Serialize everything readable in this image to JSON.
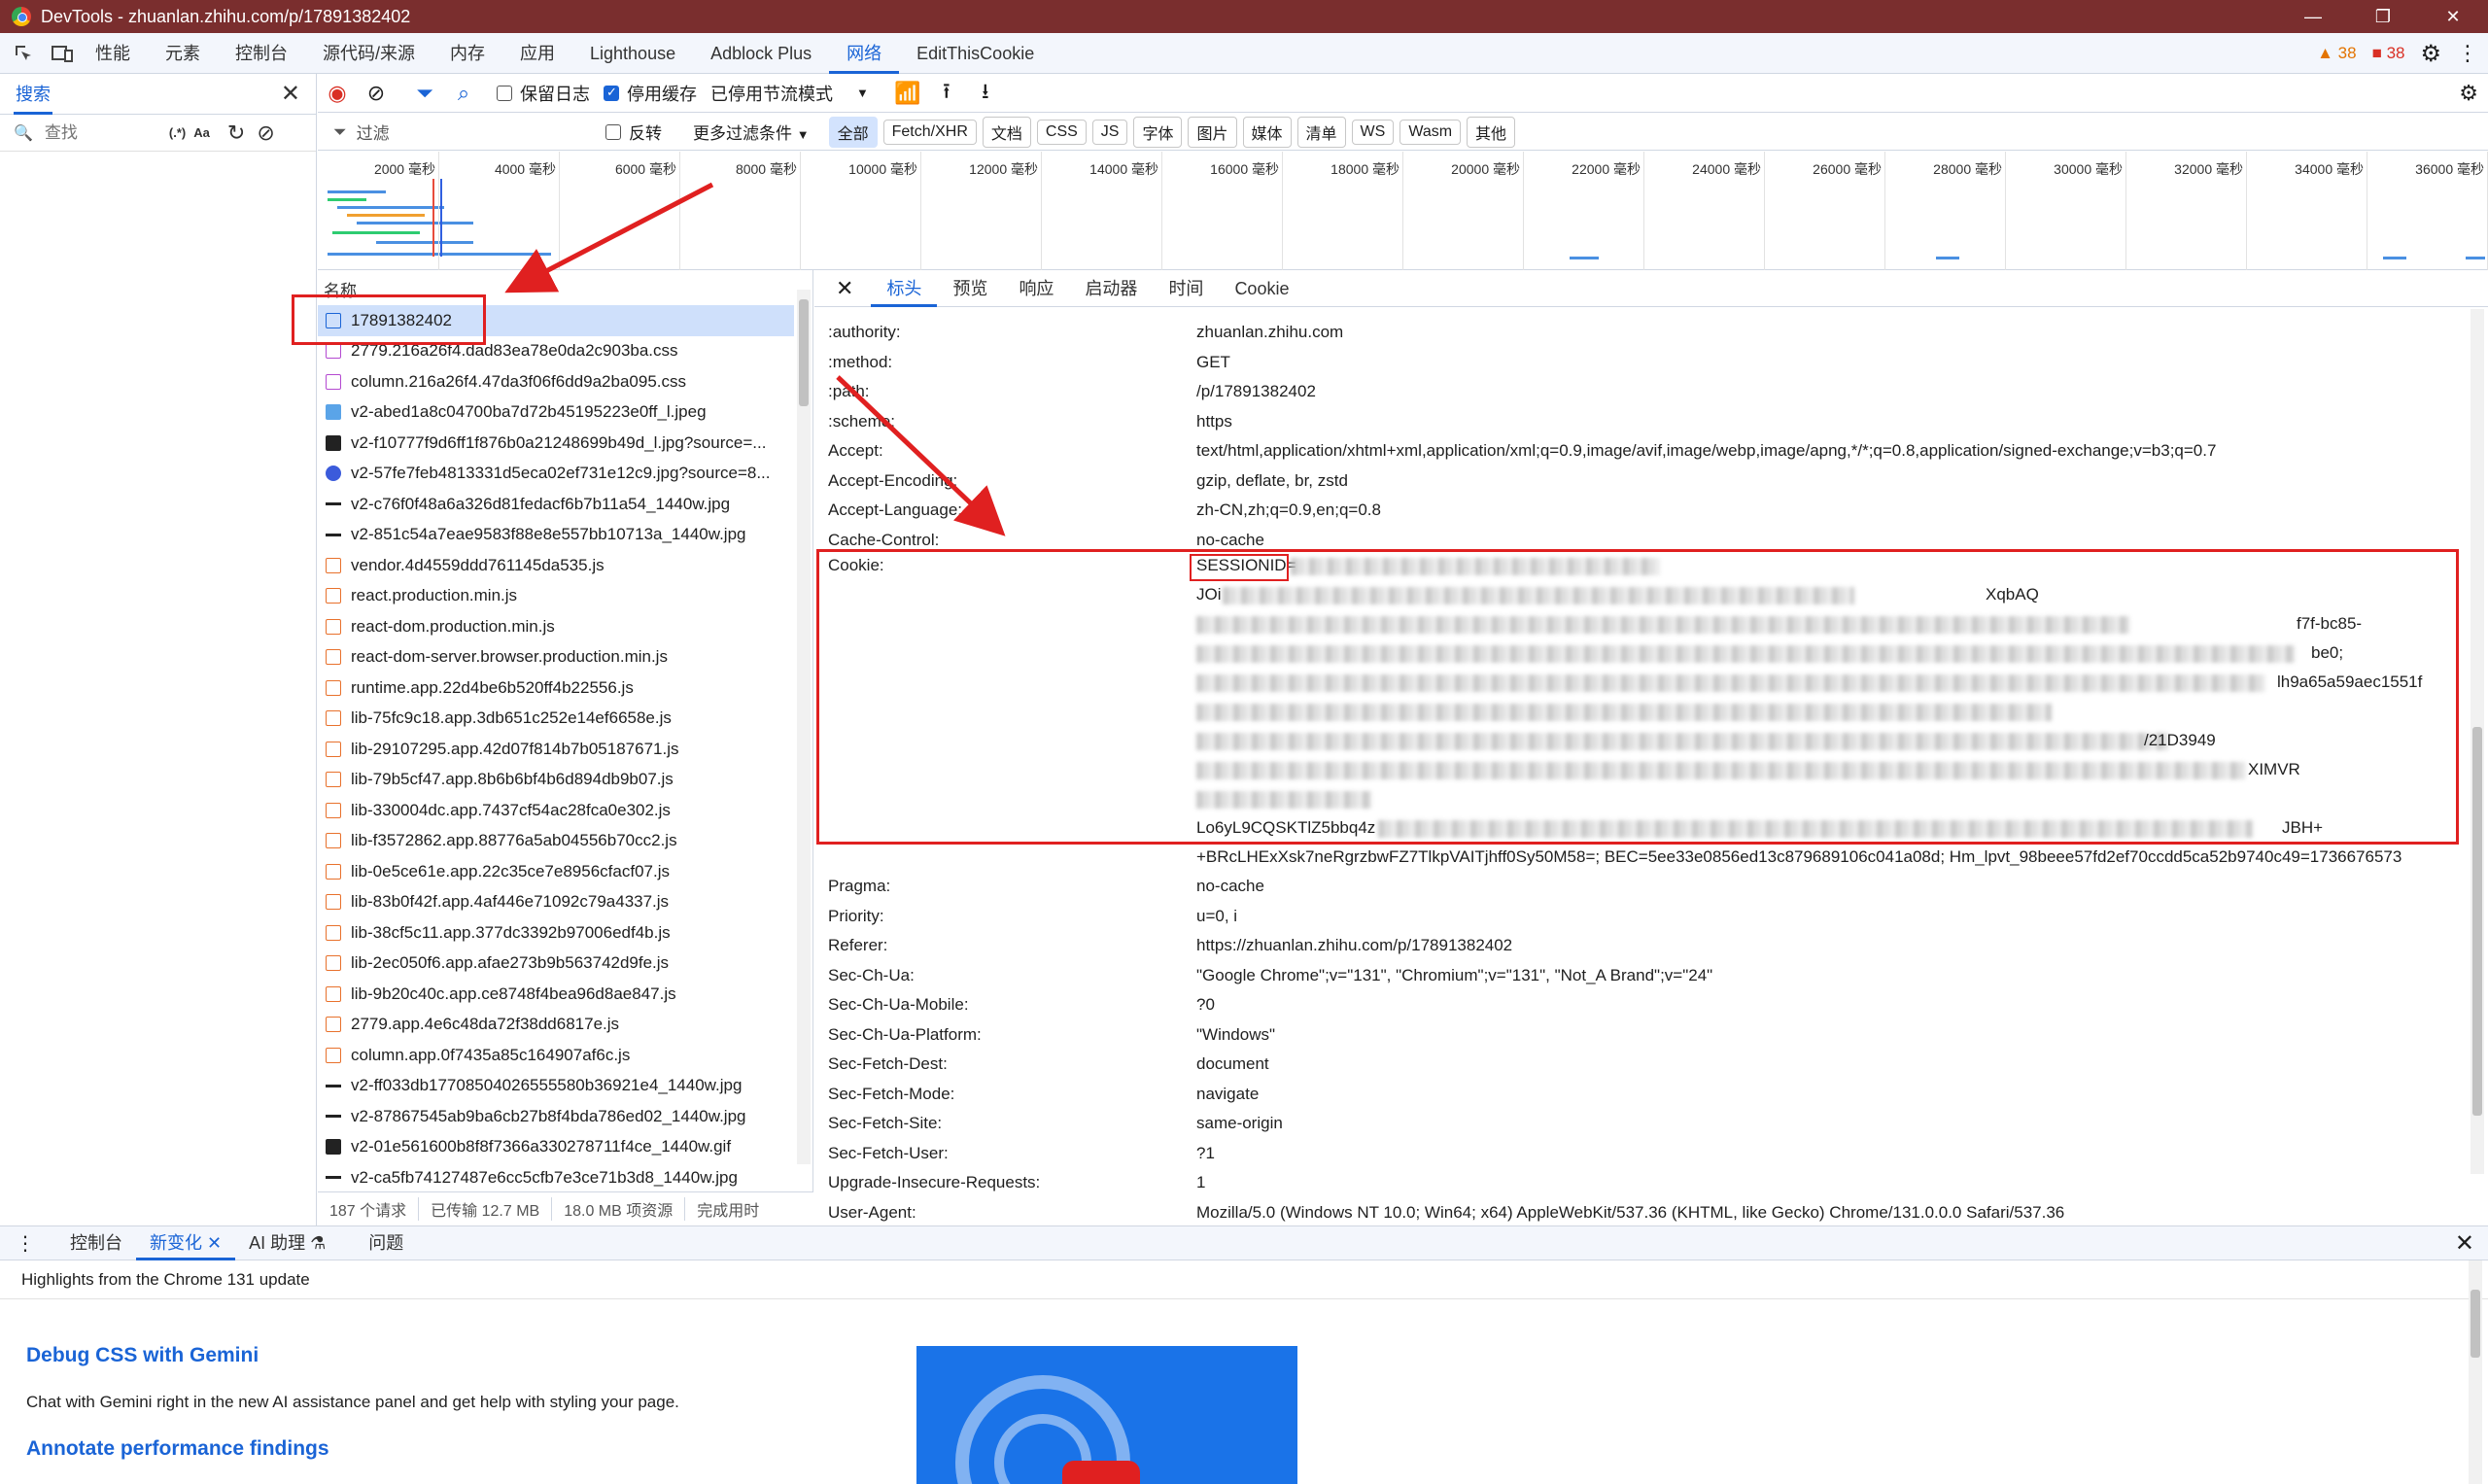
{
  "window": {
    "title": "DevTools - zhuanlan.zhihu.com/p/17891382402",
    "controls": [
      "—",
      "❐",
      "✕"
    ]
  },
  "main_tabs": [
    "性能",
    "元素",
    "控制台",
    "源代码/来源",
    "内存",
    "应用",
    "Lighthouse",
    "Adblock Plus",
    "网络",
    "EditThisCookie"
  ],
  "active_main_tab": "网络",
  "warnings_count": "38",
  "errors_count": "38",
  "search_panel": {
    "tab_label": "搜索",
    "placeholder": "查找",
    "regex_label": "(.*)",
    "case_label": "Aa"
  },
  "network_toolbar": {
    "preserve_log": "保留日志",
    "disable_cache": "停用缓存",
    "throttle": "已停用节流模式"
  },
  "filter_row": {
    "placeholder": "过滤",
    "invert": "反转",
    "more_filters": "更多过滤条件",
    "chips": [
      "全部",
      "Fetch/XHR",
      "文档",
      "CSS",
      "JS",
      "字体",
      "图片",
      "媒体",
      "清单",
      "WS",
      "Wasm",
      "其他"
    ]
  },
  "timeline_ticks": [
    "2000 毫秒",
    "4000 毫秒",
    "6000 毫秒",
    "8000 毫秒",
    "10000 毫秒",
    "12000 毫秒",
    "14000 毫秒",
    "16000 毫秒",
    "18000 毫秒",
    "20000 毫秒",
    "22000 毫秒",
    "24000 毫秒",
    "26000 毫秒",
    "28000 毫秒",
    "30000 毫秒",
    "32000 毫秒",
    "34000 毫秒",
    "36000 毫秒"
  ],
  "request_list": {
    "header": "名称",
    "rows": [
      {
        "name": "17891382402",
        "type": "doc"
      },
      {
        "name": "2779.216a26f4.dad83ea78e0da2c903ba.css",
        "type": "css"
      },
      {
        "name": "column.216a26f4.47da3f06f6dd9a2ba095.css",
        "type": "css"
      },
      {
        "name": "v2-abed1a8c04700ba7d72b45195223e0ff_l.jpeg",
        "type": "img"
      },
      {
        "name": "v2-f10777f9d6ff1f876b0a21248699b49d_l.jpg?source=...",
        "type": "imgd"
      },
      {
        "name": "v2-57fe7feb4813331d5eca02ef731e12c9.jpg?source=8...",
        "type": "bluecirc"
      },
      {
        "name": "v2-c76f0f48a6a326d81fedacf6b7b11a54_1440w.jpg",
        "type": "line"
      },
      {
        "name": "v2-851c54a7eae9583f88e8e557bb10713a_1440w.jpg",
        "type": "line"
      },
      {
        "name": "vendor.4d4559ddd761145da535.js",
        "type": "js"
      },
      {
        "name": "react.production.min.js",
        "type": "js"
      },
      {
        "name": "react-dom.production.min.js",
        "type": "js"
      },
      {
        "name": "react-dom-server.browser.production.min.js",
        "type": "js"
      },
      {
        "name": "runtime.app.22d4be6b520ff4b22556.js",
        "type": "js"
      },
      {
        "name": "lib-75fc9c18.app.3db651c252e14ef6658e.js",
        "type": "js"
      },
      {
        "name": "lib-29107295.app.42d07f814b7b05187671.js",
        "type": "js"
      },
      {
        "name": "lib-79b5cf47.app.8b6b6bf4b6d894db9b07.js",
        "type": "js"
      },
      {
        "name": "lib-330004dc.app.7437cf54ac28fca0e302.js",
        "type": "js"
      },
      {
        "name": "lib-f3572862.app.88776a5ab04556b70cc2.js",
        "type": "js"
      },
      {
        "name": "lib-0e5ce61e.app.22c35ce7e8956cfacf07.js",
        "type": "js"
      },
      {
        "name": "lib-83b0f42f.app.4af446e71092c79a4337.js",
        "type": "js"
      },
      {
        "name": "lib-38cf5c11.app.377dc3392b97006edf4b.js",
        "type": "js"
      },
      {
        "name": "lib-2ec050f6.app.afae273b9b563742d9fe.js",
        "type": "js"
      },
      {
        "name": "lib-9b20c40c.app.ce8748f4bea96d8ae847.js",
        "type": "js"
      },
      {
        "name": "2779.app.4e6c48da72f38dd6817e.js",
        "type": "js"
      },
      {
        "name": "column.app.0f7435a85c164907af6c.js",
        "type": "js"
      },
      {
        "name": "v2-ff033db17708504026555580b36921e4_1440w.jpg",
        "type": "line"
      },
      {
        "name": "v2-87867545ab9ba6cb27b8f4bda786ed02_1440w.jpg",
        "type": "line"
      },
      {
        "name": "v2-01e561600b8f8f7366a330278711f4ce_1440w.gif",
        "type": "imgd"
      },
      {
        "name": "v2-ca5fb74127487e6cc5cfb7e3ce71b3d8_1440w.jpg",
        "type": "line"
      }
    ]
  },
  "status_bar": [
    "187 个请求",
    "已传输 12.7 MB",
    "18.0 MB 项资源",
    "完成用时"
  ],
  "detail_tabs": [
    "标头",
    "预览",
    "响应",
    "启动器",
    "时间",
    "Cookie"
  ],
  "active_detail_tab": "标头",
  "headers": [
    {
      "k": ":authority:",
      "v": "zhuanlan.zhihu.com"
    },
    {
      "k": ":method:",
      "v": "GET"
    },
    {
      "k": ":path:",
      "v": "/p/17891382402"
    },
    {
      "k": ":scheme:",
      "v": "https"
    },
    {
      "k": "Accept:",
      "v": "text/html,application/xhtml+xml,application/xml;q=0.9,image/avif,image/webp,image/apng,*/*;q=0.8,application/signed-exchange;v=b3;q=0.7"
    },
    {
      "k": "Accept-Encoding:",
      "v": "gzip, deflate, br, zstd"
    },
    {
      "k": "Accept-Language:",
      "v": "zh-CN,zh;q=0.9,en;q=0.8"
    },
    {
      "k": "Cache-Control:",
      "v": "no-cache"
    }
  ],
  "cookie": {
    "key": "Cookie:",
    "session_label": "SESSIONID=",
    "frag_1": "JOi",
    "frag_2": "XqbAQ",
    "frag_3": "f7f-bc85-",
    "frag_4": "be0;",
    "frag_5": "lh9a65a59aec1551f",
    "frag_6": "/21D3949",
    "frag_7": "XIMVR",
    "frag_8": "Lo6yL9CQSKTlZ5bbq4z",
    "frag_9": "JBH+",
    "tail": "+BRcLHExXsk7neRgrzbwFZ7TlkpVAITjhff0Sy50M58=; BEC=5ee33e0856ed13c879689106c041a08d; Hm_lpvt_98beee57fd2ef70ccdd5ca52b9740c49=1736676573"
  },
  "headers_after": [
    {
      "k": "Pragma:",
      "v": "no-cache"
    },
    {
      "k": "Priority:",
      "v": "u=0, i"
    },
    {
      "k": "Referer:",
      "v": "https://zhuanlan.zhihu.com/p/17891382402"
    },
    {
      "k": "Sec-Ch-Ua:",
      "v": "\"Google Chrome\";v=\"131\", \"Chromium\";v=\"131\", \"Not_A Brand\";v=\"24\""
    },
    {
      "k": "Sec-Ch-Ua-Mobile:",
      "v": "?0"
    },
    {
      "k": "Sec-Ch-Ua-Platform:",
      "v": "\"Windows\""
    },
    {
      "k": "Sec-Fetch-Dest:",
      "v": "document"
    },
    {
      "k": "Sec-Fetch-Mode:",
      "v": "navigate"
    },
    {
      "k": "Sec-Fetch-Site:",
      "v": "same-origin"
    },
    {
      "k": "Sec-Fetch-User:",
      "v": "?1"
    },
    {
      "k": "Upgrade-Insecure-Requests:",
      "v": "1"
    },
    {
      "k": "User-Agent:",
      "v": "Mozilla/5.0 (Windows NT 10.0; Win64; x64) AppleWebKit/537.36 (KHTML, like Gecko) Chrome/131.0.0.0 Safari/537.36"
    }
  ],
  "drawer": {
    "tabs": [
      "控制台",
      "新变化",
      "AI 助理",
      "问题"
    ],
    "active": "新变化",
    "highlight": "Highlights from the Chrome 131 update",
    "heading1": "Debug CSS with Gemini",
    "text1": "Chat with Gemini right in the new AI assistance panel and get help with styling your page.",
    "heading2": "Annotate performance findings"
  },
  "colors": {
    "accent": "#1a64d6",
    "titlebar": "#7a2e2e",
    "annotation": "#e02020"
  }
}
